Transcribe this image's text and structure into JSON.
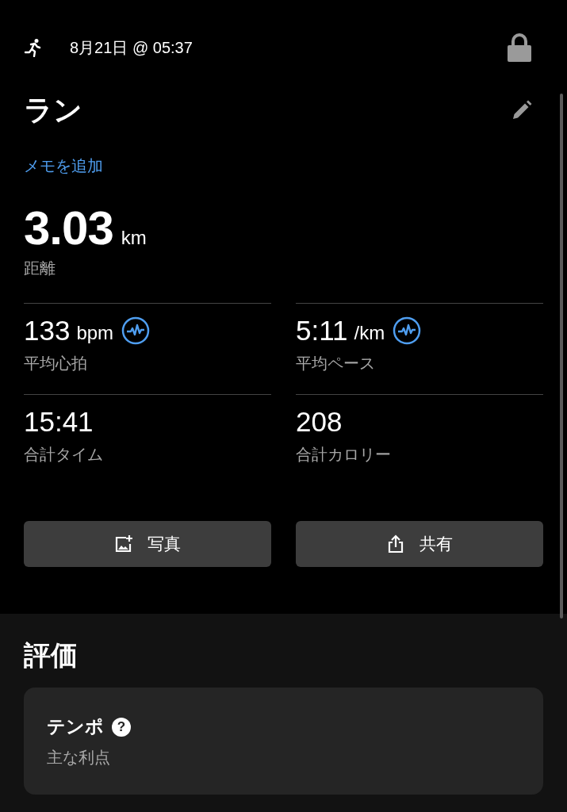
{
  "header": {
    "datetime": "8月21日 @ 05:37"
  },
  "activity": {
    "title": "ラン",
    "add_note": "メモを追加"
  },
  "distance": {
    "value": "3.03",
    "unit": "km",
    "label": "距離"
  },
  "metrics": [
    {
      "value": "133",
      "unit": "bpm",
      "label": "平均心拍",
      "chart_icon": true
    },
    {
      "value": "5:11",
      "unit": "/km",
      "label": "平均ペース",
      "chart_icon": true
    },
    {
      "value": "15:41",
      "label": "合計タイム",
      "chart_icon": false
    },
    {
      "value": "208",
      "label": "合計カロリー",
      "chart_icon": false
    }
  ],
  "buttons": [
    {
      "kind": "photo",
      "label": "写真"
    },
    {
      "kind": "share",
      "label": "共有"
    }
  ],
  "evaluation": {
    "heading": "評価",
    "card": {
      "title": "テンポ",
      "help": "?",
      "subtitle": "主な利点"
    }
  }
}
